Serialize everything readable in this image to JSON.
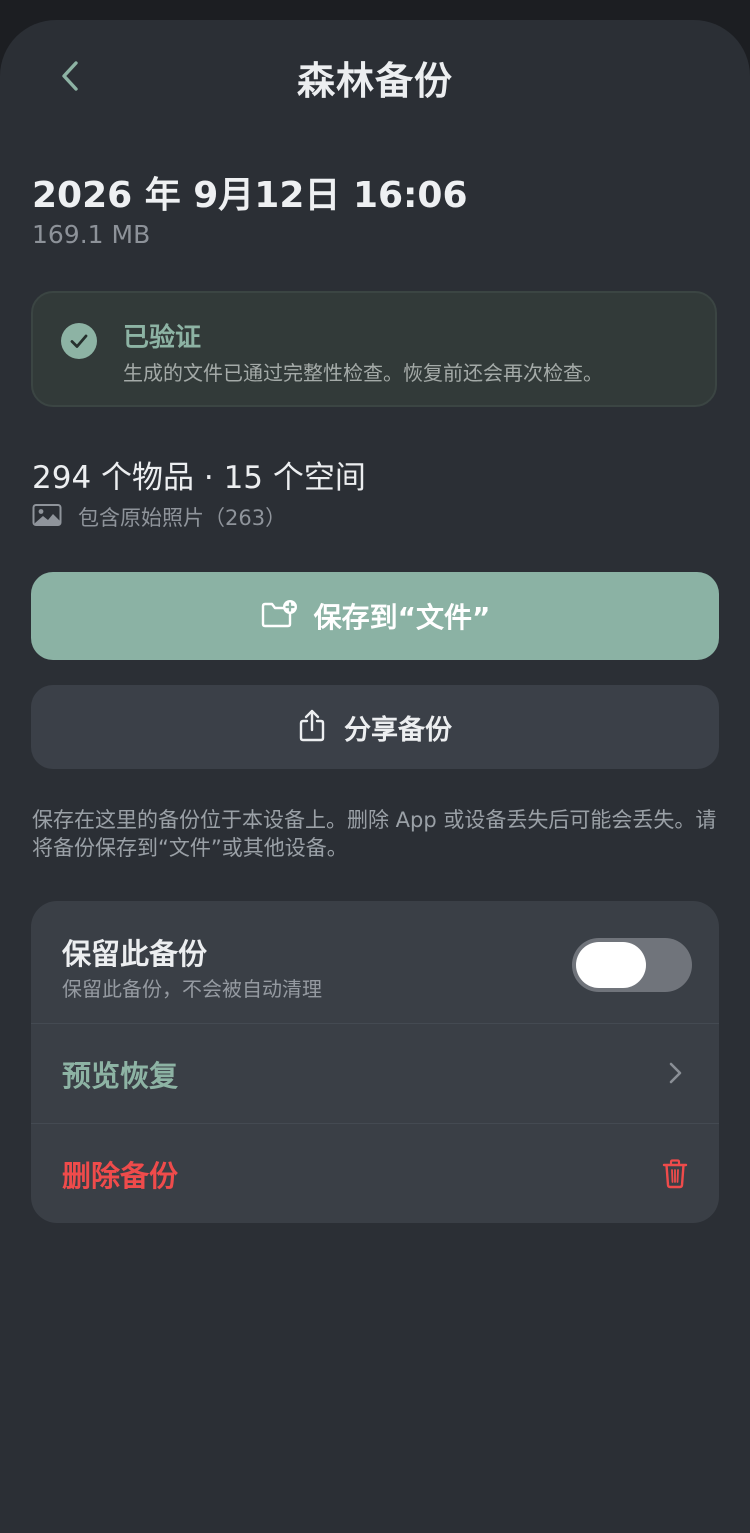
{
  "nav": {
    "title": "森林备份",
    "back_icon": "chevron-left-icon"
  },
  "backup": {
    "date": "2026 年 9月12日 16:06",
    "size": "169.1 MB"
  },
  "verification": {
    "title": "已验证",
    "description": "生成的文件已通过完整性检查。恢复前还会再次检查。",
    "icon": "check-circle-icon",
    "accent_color": "#8db3a4"
  },
  "contents": {
    "summary": "294 个物品 · 15 个空间",
    "photos_label": "包含原始照片（263）",
    "photos_icon": "image-icon"
  },
  "actions": {
    "save_label": "保存到“文件”",
    "save_icon": "folder-plus-icon",
    "share_label": "分享备份",
    "share_icon": "share-icon"
  },
  "note": "保存在这里的备份位于本设备上。删除 App 或设备丢失后可能会丢失。请将备份保存到“文件”或其他设备。",
  "settings": {
    "keep_title": "保留此备份",
    "keep_subtitle": "保留此备份，不会被自动清理",
    "keep_enabled": false,
    "preview_label": "预览恢复",
    "preview_icon": "chevron-right-icon",
    "delete_label": "删除备份",
    "delete_icon": "trash-icon",
    "delete_color": "#ef4b4b"
  },
  "colors": {
    "background": "#2b2f35",
    "primary_button": "#8bb2a4",
    "card": "#3a3f46"
  }
}
